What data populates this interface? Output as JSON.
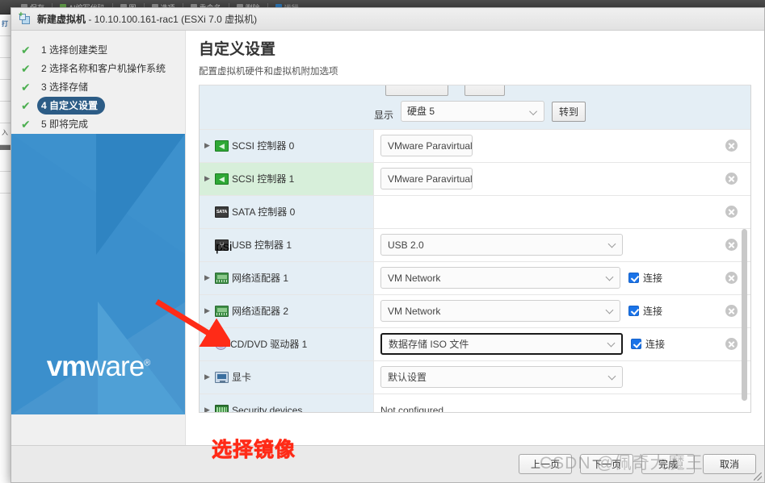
{
  "background": {
    "toolbar_items": [
      "保存",
      "AI编写代码",
      "图",
      "选项",
      "重命名",
      "删除",
      "运行"
    ],
    "left_text": "打",
    "left_text2": "入"
  },
  "dialog": {
    "title_prefix": "新建虚拟机",
    "title_suffix": " - 10.10.100.161-rac1 (ESXi 7.0 虚拟机)",
    "icon": "new-vm-icon"
  },
  "wizard": {
    "steps": [
      {
        "num": "1",
        "label": "1 选择创建类型",
        "done": true,
        "active": false
      },
      {
        "num": "2",
        "label": "2 选择名称和客户机操作系统",
        "done": true,
        "active": false
      },
      {
        "num": "3",
        "label": "3 选择存储",
        "done": true,
        "active": false
      },
      {
        "num": "4",
        "label": "4 自定义设置",
        "done": true,
        "active": true
      },
      {
        "num": "5",
        "label": "5 即将完成",
        "done": true,
        "active": false
      }
    ],
    "brand": {
      "vm": "vm",
      "ware": "ware",
      "reg": "®"
    }
  },
  "content": {
    "title": "自定义设置",
    "subtitle": "配置虚拟机硬件和虚拟机附加选项"
  },
  "show_bar": {
    "label": "显示",
    "selected": "硬盘 5",
    "goto_button": "转到"
  },
  "hardware_rows": [
    {
      "name": "SCSI 控制器 0",
      "icon": "scsi-controller-icon",
      "icon_kind": "scsi",
      "expandable": true,
      "highlight": false,
      "value": "VMware Paravirtual",
      "value_kind": "field",
      "field_width": "w-para",
      "has_caret": false,
      "connect": null,
      "removable": true
    },
    {
      "name": "SCSI 控制器 1",
      "icon": "scsi-controller-icon",
      "icon_kind": "scsi",
      "expandable": true,
      "highlight": true,
      "value": "VMware Paravirtual",
      "value_kind": "field",
      "field_width": "w-para",
      "has_caret": false,
      "connect": null,
      "removable": true
    },
    {
      "name": "SATA 控制器 0",
      "icon": "sata-controller-icon",
      "icon_kind": "sata",
      "expandable": false,
      "highlight": false,
      "value": "",
      "value_kind": "empty",
      "field_width": "",
      "has_caret": false,
      "connect": null,
      "removable": true
    },
    {
      "name": "USB 控制器 1",
      "icon": "usb-controller-icon",
      "icon_kind": "usb",
      "expandable": false,
      "highlight": false,
      "value": "USB 2.0",
      "value_kind": "select",
      "field_width": "w-usb",
      "has_caret": true,
      "connect": null,
      "removable": true
    },
    {
      "name": "网络适配器 1",
      "icon": "network-adapter-icon",
      "icon_kind": "net",
      "expandable": true,
      "highlight": false,
      "value": "VM Network",
      "value_kind": "select",
      "field_width": "w-net",
      "has_caret": true,
      "connect": "连接",
      "connect_checked": true,
      "removable": true
    },
    {
      "name": "网络适配器 2",
      "icon": "network-adapter-icon",
      "icon_kind": "net",
      "expandable": true,
      "highlight": false,
      "value": "VM Network",
      "value_kind": "select",
      "field_width": "w-net",
      "has_caret": true,
      "connect": "连接",
      "connect_checked": true,
      "removable": true
    },
    {
      "name": "CD/DVD 驱动器 1",
      "icon": "cd-dvd-drive-icon",
      "icon_kind": "cd",
      "expandable": true,
      "highlight": false,
      "value": "数据存储 ISO 文件",
      "value_kind": "select",
      "field_width": "w-cd",
      "has_caret": true,
      "focused": true,
      "connect": "连接",
      "connect_checked": true,
      "removable": true
    },
    {
      "name": "显卡",
      "icon": "video-card-icon",
      "icon_kind": "vga",
      "expandable": true,
      "highlight": false,
      "value": "默认设置",
      "value_kind": "select",
      "field_width": "w-vga",
      "has_caret": true,
      "connect": null,
      "removable": false
    },
    {
      "name": "Security devices",
      "icon": "security-device-icon",
      "icon_kind": "sec",
      "expandable": true,
      "highlight": false,
      "value": "Not configured",
      "value_kind": "text",
      "field_width": "",
      "has_caret": false,
      "connect": null,
      "removable": false
    }
  ],
  "scrollbar": {
    "thumb_top_pct": 44,
    "thumb_height_pct": 53
  },
  "footer": {
    "buttons": [
      {
        "label": "上一页",
        "name": "back-button"
      },
      {
        "label": "下一页",
        "name": "next-button"
      },
      {
        "label": "完成",
        "name": "finish-button"
      },
      {
        "label": "取消",
        "name": "cancel-button"
      }
    ]
  },
  "annotations": {
    "red_text": "选择镜像",
    "arrow": "red-arrow-pointing-to-cd-dvd-row",
    "watermark": "CSDN @佩奇大魔王"
  }
}
